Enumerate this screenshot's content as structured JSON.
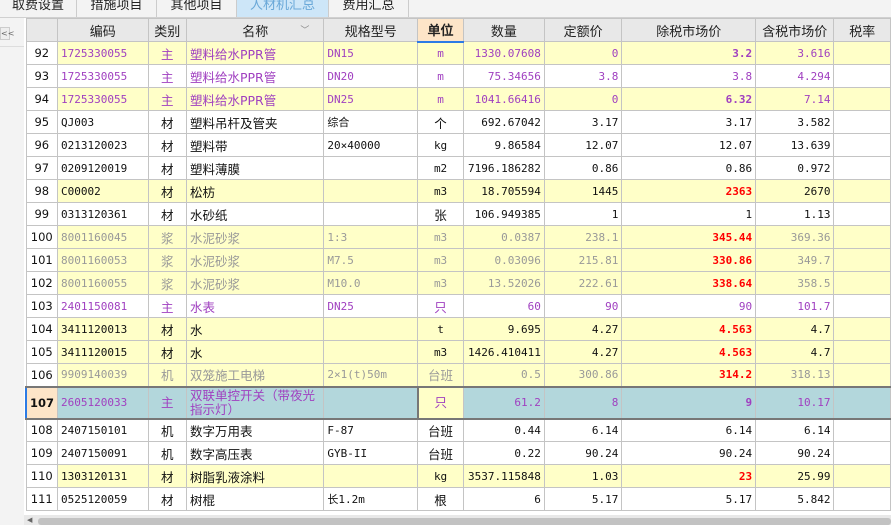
{
  "tabs": [
    {
      "label": "取费设置",
      "active": false
    },
    {
      "label": "措施项目",
      "active": false
    },
    {
      "label": "其他项目",
      "active": false
    },
    {
      "label": "人材机汇总",
      "active": true
    },
    {
      "label": "费用汇总",
      "active": false
    }
  ],
  "collapse_label": "<<",
  "columns": [
    "",
    "编码",
    "类别",
    "名称",
    "规格型号",
    "单位",
    "数量",
    "定额价",
    "除税市场价",
    "含税市场价",
    "税率"
  ],
  "colors": {
    "main": "#a040c0",
    "gray": "#999999",
    "red": "#ff0000",
    "yellow": "#ffffc8",
    "selected": "#b3d7dc"
  },
  "rows": [
    {
      "n": "92",
      "code": "1725330055",
      "type": "主",
      "name": "塑料给水PPR管",
      "spec": "DN15",
      "unit": "m",
      "qty": "1330.07608",
      "quota": "0",
      "price": "3.2",
      "taxprice": "3.616",
      "style": "main",
      "yellow": true,
      "price_style": "bold"
    },
    {
      "n": "93",
      "code": "1725330055",
      "type": "主",
      "name": "塑料给水PPR管",
      "spec": "DN20",
      "unit": "m",
      "qty": "75.34656",
      "quota": "3.8",
      "price": "3.8",
      "taxprice": "4.294",
      "style": "main",
      "yellow": false,
      "price_style": ""
    },
    {
      "n": "94",
      "code": "1725330055",
      "type": "主",
      "name": "塑料给水PPR管",
      "spec": "DN25",
      "unit": "m",
      "qty": "1041.66416",
      "quota": "0",
      "price": "6.32",
      "taxprice": "7.14",
      "style": "main",
      "yellow": true,
      "price_style": "bold"
    },
    {
      "n": "95",
      "code": "QJ003",
      "type": "材",
      "name": "塑料吊杆及管夹",
      "spec": "综合",
      "unit": "个",
      "qty": "692.67042",
      "quota": "3.17",
      "price": "3.17",
      "taxprice": "3.582",
      "style": "",
      "yellow": false,
      "price_style": ""
    },
    {
      "n": "96",
      "code": "0213120023",
      "type": "材",
      "name": "塑料带",
      "spec": "20×40000",
      "unit": "kg",
      "qty": "9.86584",
      "quota": "12.07",
      "price": "12.07",
      "taxprice": "13.639",
      "style": "",
      "yellow": false,
      "price_style": ""
    },
    {
      "n": "97",
      "code": "0209120019",
      "type": "材",
      "name": "塑料薄膜",
      "spec": "",
      "unit": "m2",
      "qty": "7196.186282",
      "quota": "0.86",
      "price": "0.86",
      "taxprice": "0.972",
      "style": "",
      "yellow": false,
      "price_style": ""
    },
    {
      "n": "98",
      "code": "C00002",
      "type": "材",
      "name": "松枋",
      "spec": "",
      "unit": "m3",
      "qty": "18.705594",
      "quota": "1445",
      "price": "2363",
      "taxprice": "2670",
      "style": "",
      "yellow": true,
      "price_style": "red"
    },
    {
      "n": "99",
      "code": "0313120361",
      "type": "材",
      "name": "水砂纸",
      "spec": "",
      "unit": "张",
      "qty": "106.949385",
      "quota": "1",
      "price": "1",
      "taxprice": "1.13",
      "style": "",
      "yellow": false,
      "price_style": ""
    },
    {
      "n": "100",
      "code": "8001160045",
      "type": "浆",
      "name": "水泥砂浆",
      "spec": "1:3",
      "unit": "m3",
      "qty": "0.0387",
      "quota": "238.1",
      "price": "345.44",
      "taxprice": "369.36",
      "style": "gray",
      "yellow": true,
      "price_style": "red"
    },
    {
      "n": "101",
      "code": "8001160053",
      "type": "浆",
      "name": "水泥砂浆",
      "spec": "M7.5",
      "unit": "m3",
      "qty": "0.03096",
      "quota": "215.81",
      "price": "330.86",
      "taxprice": "349.7",
      "style": "gray",
      "yellow": true,
      "price_style": "red"
    },
    {
      "n": "102",
      "code": "8001160055",
      "type": "浆",
      "name": "水泥砂浆",
      "spec": "M10.0",
      "unit": "m3",
      "qty": "13.52026",
      "quota": "222.61",
      "price": "338.64",
      "taxprice": "358.5",
      "style": "gray",
      "yellow": true,
      "price_style": "red"
    },
    {
      "n": "103",
      "code": "2401150081",
      "type": "主",
      "name": "水表",
      "spec": "DN25",
      "unit": "只",
      "qty": "60",
      "quota": "90",
      "price": "90",
      "taxprice": "101.7",
      "style": "main",
      "yellow": false,
      "price_style": ""
    },
    {
      "n": "104",
      "code": "3411120013",
      "type": "材",
      "name": "水",
      "spec": "",
      "unit": "t",
      "qty": "9.695",
      "quota": "4.27",
      "price": "4.563",
      "taxprice": "4.7",
      "style": "",
      "yellow": true,
      "price_style": "red"
    },
    {
      "n": "105",
      "code": "3411120015",
      "type": "材",
      "name": "水",
      "spec": "",
      "unit": "m3",
      "qty": "1426.410411",
      "quota": "4.27",
      "price": "4.563",
      "taxprice": "4.7",
      "style": "",
      "yellow": true,
      "price_style": "red"
    },
    {
      "n": "106",
      "code": "9909140039",
      "type": "机",
      "name": "双笼施工电梯",
      "spec": "2×1(t)50m",
      "unit": "台班",
      "qty": "0.5",
      "quota": "300.86",
      "price": "314.2",
      "taxprice": "318.13",
      "style": "gray",
      "yellow": true,
      "price_style": "red"
    },
    {
      "n": "107",
      "code": "2605120033",
      "type": "主",
      "name": "双联单控开关（带夜光指示灯）",
      "spec": "",
      "unit": "只",
      "qty": "61.2",
      "quota": "8",
      "price": "9",
      "taxprice": "10.17",
      "style": "main",
      "yellow": false,
      "price_style": "bold",
      "selected": true
    },
    {
      "n": "108",
      "code": "2407150101",
      "type": "机",
      "name": "数字万用表",
      "spec": "F-87",
      "unit": "台班",
      "qty": "0.44",
      "quota": "6.14",
      "price": "6.14",
      "taxprice": "6.14",
      "style": "",
      "yellow": false,
      "price_style": ""
    },
    {
      "n": "109",
      "code": "2407150091",
      "type": "机",
      "name": "数字高压表",
      "spec": "GYB-II",
      "unit": "台班",
      "qty": "0.22",
      "quota": "90.24",
      "price": "90.24",
      "taxprice": "90.24",
      "style": "",
      "yellow": false,
      "price_style": ""
    },
    {
      "n": "110",
      "code": "1303120131",
      "type": "材",
      "name": "树脂乳液涂料",
      "spec": "",
      "unit": "kg",
      "qty": "3537.115848",
      "quota": "1.03",
      "price": "23",
      "taxprice": "25.99",
      "style": "",
      "yellow": true,
      "price_style": "red"
    },
    {
      "n": "111",
      "code": "0525120059",
      "type": "材",
      "name": "树棍",
      "spec": "长1.2m",
      "unit": "根",
      "qty": "6",
      "quota": "5.17",
      "price": "5.17",
      "taxprice": "5.842",
      "style": "",
      "yellow": false,
      "price_style": ""
    }
  ]
}
